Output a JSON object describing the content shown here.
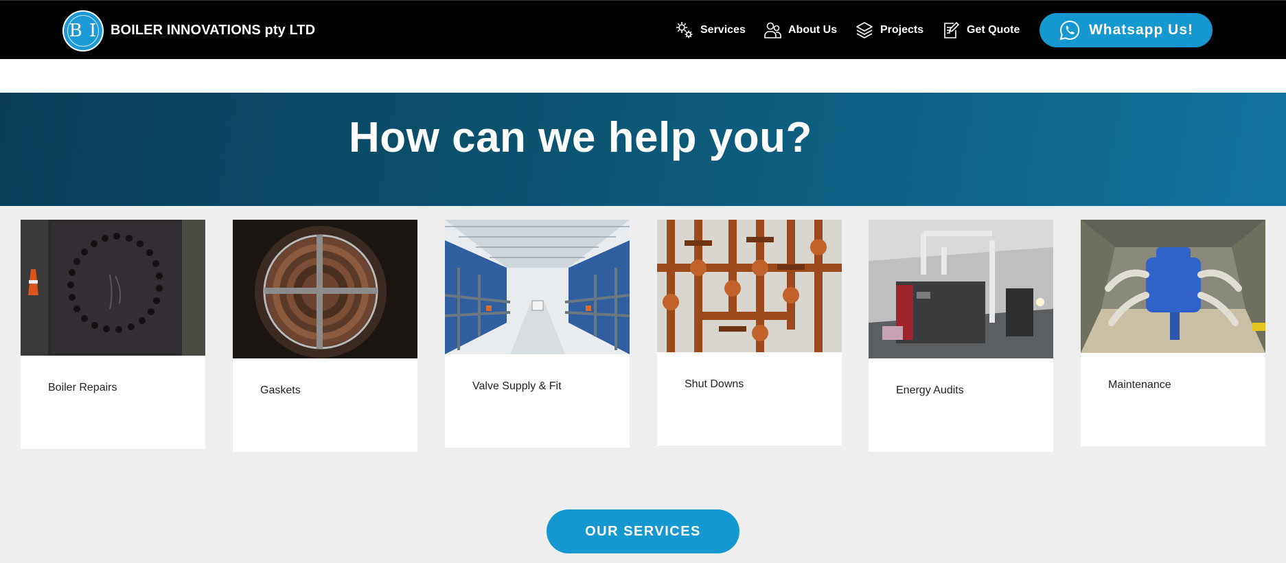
{
  "header": {
    "logo_text": "B I",
    "brand_name": "BOILER INNOVATIONS pty LTD",
    "nav": [
      {
        "label": "Services",
        "icon": "gears-icon"
      },
      {
        "label": "About Us",
        "icon": "users-icon"
      },
      {
        "label": "Projects",
        "icon": "layers-icon"
      },
      {
        "label": "Get Quote",
        "icon": "edit-document-icon"
      }
    ],
    "whatsapp_label": "Whatsapp Us!",
    "whatsapp_icon": "whatsapp-icon"
  },
  "hero": {
    "title": "How can we help you?"
  },
  "services": [
    {
      "label": "Boiler Repairs"
    },
    {
      "label": "Gaskets"
    },
    {
      "label": "Valve Supply & Fit"
    },
    {
      "label": "Shut Downs"
    },
    {
      "label": "Energy Audits"
    },
    {
      "label": "Maintenance"
    }
  ],
  "cta": {
    "label": "OUR SERVICES"
  },
  "colors": {
    "accent": "#1598d0",
    "header_bg": "#000000",
    "hero_start": "#083d55",
    "hero_end": "#1172a0",
    "page_bg": "#eeeeee"
  }
}
